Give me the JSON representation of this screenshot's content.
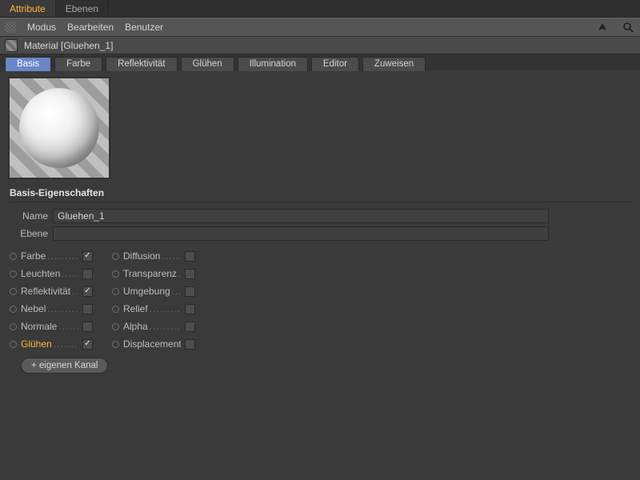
{
  "window_tabs": {
    "attribute": "Attribute",
    "layers": "Ebenen"
  },
  "menubar": {
    "mode": "Modus",
    "edit": "Bearbeiten",
    "user": "Benutzer"
  },
  "header": {
    "title": "Material [Gluehen_1]"
  },
  "tabs": {
    "basis": "Basis",
    "farbe": "Farbe",
    "reflekt": "Reflektivität",
    "gluehen": "Glühen",
    "illum": "Illumination",
    "editor": "Editor",
    "zuweisen": "Zuweisen"
  },
  "section": {
    "title": "Basis-Eigenschaften"
  },
  "fields": {
    "name_label": "Name",
    "name_value": "Gluehen_1",
    "layer_label": "Ebene"
  },
  "channels": {
    "left": [
      {
        "label": "Farbe",
        "checked": true,
        "selected": false
      },
      {
        "label": "Leuchten",
        "checked": false,
        "selected": false
      },
      {
        "label": "Reflektivität",
        "checked": true,
        "selected": false
      },
      {
        "label": "Nebel",
        "checked": false,
        "selected": false
      },
      {
        "label": "Normale",
        "checked": false,
        "selected": false
      },
      {
        "label": "Glühen",
        "checked": true,
        "selected": true
      }
    ],
    "right": [
      {
        "label": "Diffusion",
        "checked": false
      },
      {
        "label": "Transparenz",
        "checked": false
      },
      {
        "label": "Umgebung",
        "checked": false
      },
      {
        "label": "Relief",
        "checked": false
      },
      {
        "label": "Alpha",
        "checked": false
      },
      {
        "label": "Displacement",
        "checked": false
      }
    ]
  },
  "buttons": {
    "custom_channel": "+ eigenen Kanal"
  }
}
